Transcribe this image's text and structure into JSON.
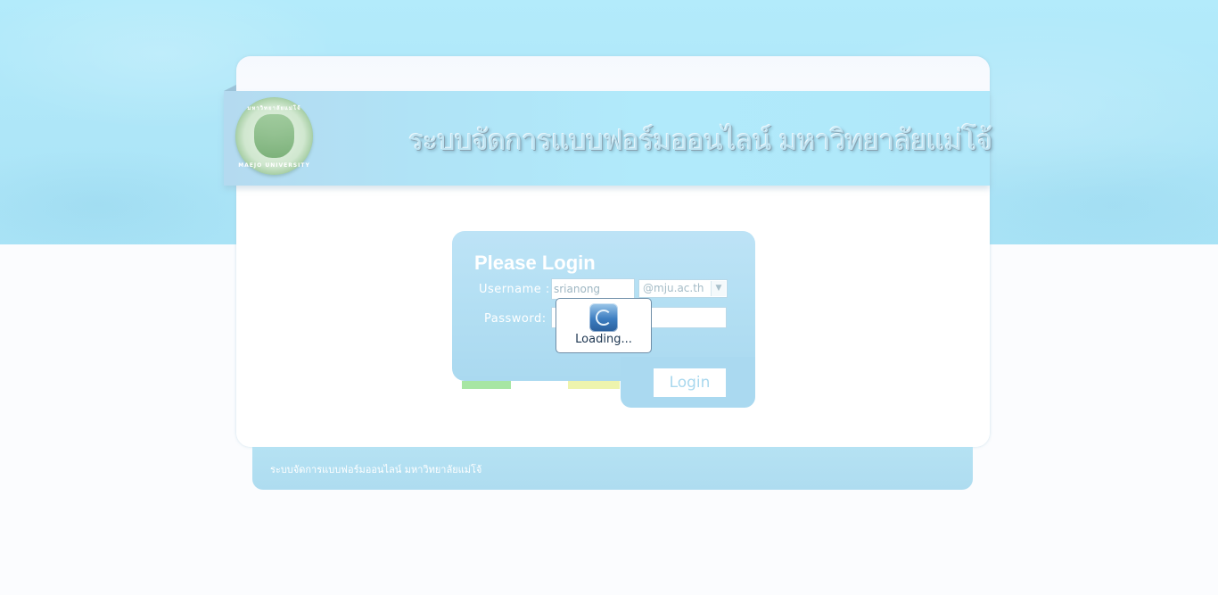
{
  "header": {
    "title": "ระบบจัดการแบบฟอร์มออนไลน์ มหาวิทยาลัยแม่โจ้",
    "logo": {
      "icon": "university-seal-logo",
      "text_top": "มหาวิทยาลัยแม่โจ้",
      "text_bottom": "MAEJO UNIVERSITY"
    }
  },
  "login": {
    "title": "Please Login",
    "username_label": "Username :",
    "username_value": "srianong",
    "domain_selected": "@mju.ac.th",
    "password_label": "Password:",
    "password_value": "",
    "button_label": "Login"
  },
  "loading": {
    "text": "Loading...",
    "icon": "loading-spinner-icon"
  },
  "footer": {
    "text": "ระบบจัดการแบบฟอร์มออนไลน์ มหาวิทยาลัยแม่โจ้"
  },
  "colors": {
    "background_top": "#b3ebfb",
    "login_panel": "#b3dff3",
    "accent_green": "#a7e6a3",
    "accent_yellow": "#eef4ad"
  }
}
